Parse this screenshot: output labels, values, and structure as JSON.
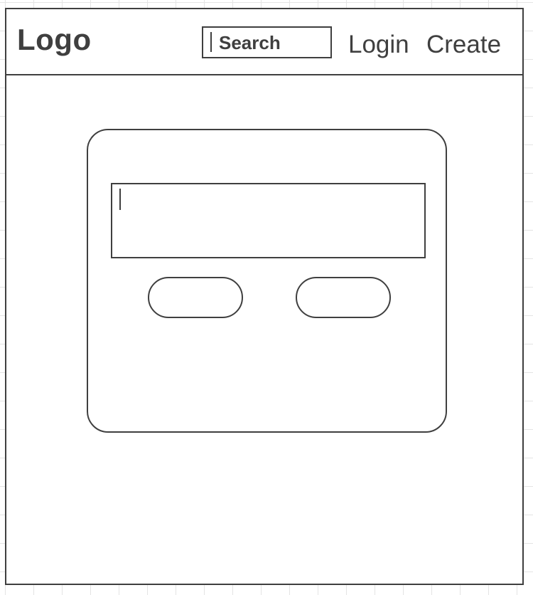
{
  "header": {
    "logo": "Logo",
    "search": {
      "placeholder": "Search"
    },
    "nav": {
      "login": "Login",
      "create": "Create"
    }
  },
  "card": {
    "text_input": {
      "value": ""
    },
    "buttons": {
      "left_label": "",
      "right_label": ""
    }
  },
  "colors": {
    "stroke": "#3f3f3f",
    "grid": "#e4e4e4",
    "background": "#ffffff"
  }
}
